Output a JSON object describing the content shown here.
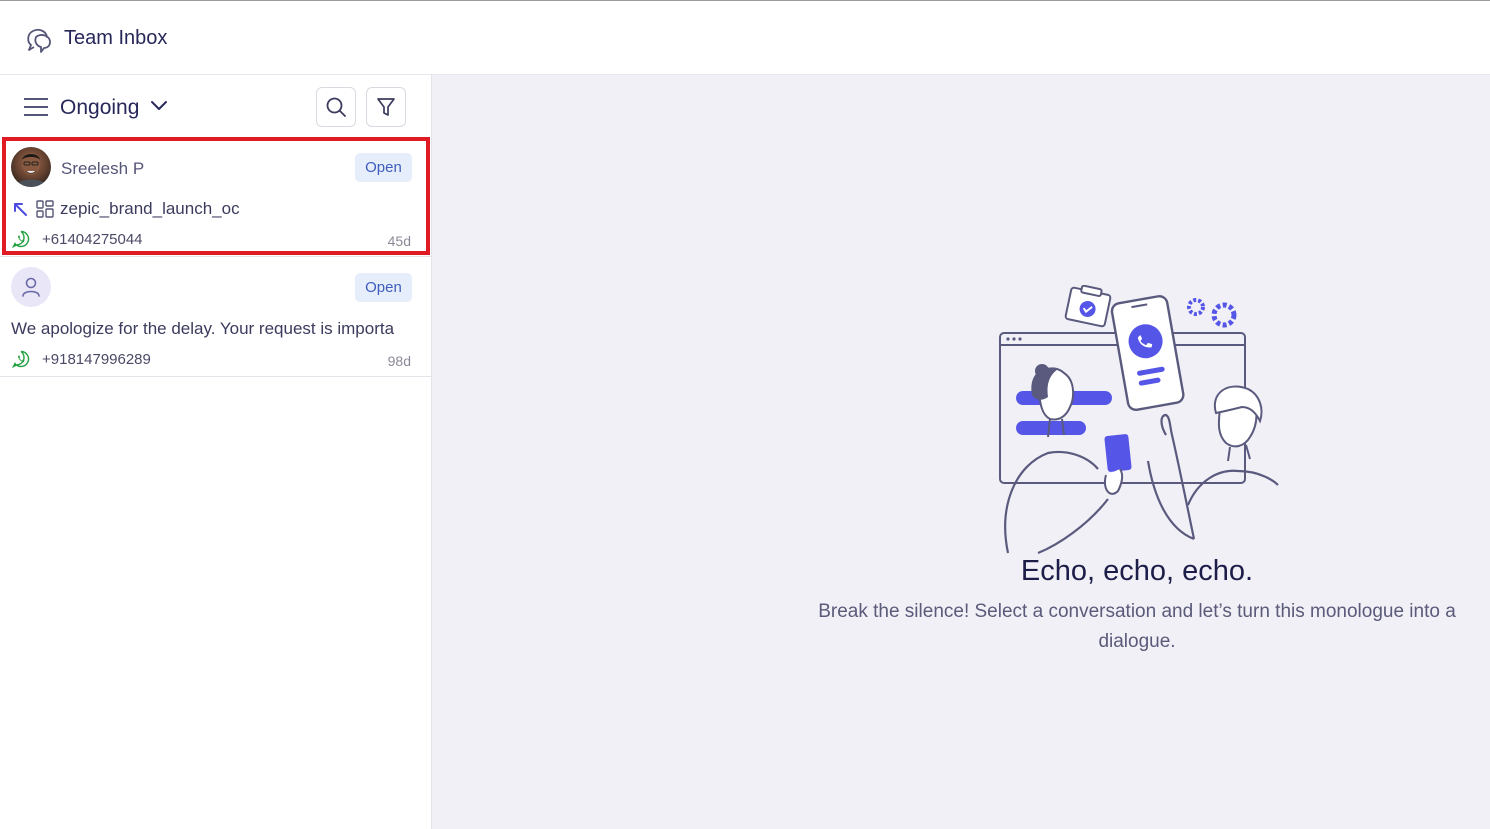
{
  "header": {
    "title": "Team Inbox",
    "logo_icon": "chat-bubbles-icon"
  },
  "toolbar": {
    "view_label": "Ongoing"
  },
  "conversations": [
    {
      "name": "Sreelesh P",
      "status": "Open",
      "campaign": "zepic_brand_launch_oc",
      "phone": "+61404275044",
      "age": "45d",
      "channel_icon": "whatsapp-icon"
    },
    {
      "name": "",
      "status": "Open",
      "preview": "We apologize for the delay. Your request is importa",
      "phone": "+918147996289",
      "age": "98d",
      "channel_icon": "whatsapp-icon"
    }
  ],
  "empty_state": {
    "title": "Echo, echo, echo.",
    "subtitle": "Break the silence! Select a conversation and let’s turn this monologue into a dialogue."
  },
  "colors": {
    "accent": "#5050e6",
    "badge_bg": "#e7eefb",
    "badge_text": "#3c5dbd",
    "whatsapp": "#25a244",
    "highlight": "#e01b24",
    "main_bg": "#f1f0f6"
  }
}
